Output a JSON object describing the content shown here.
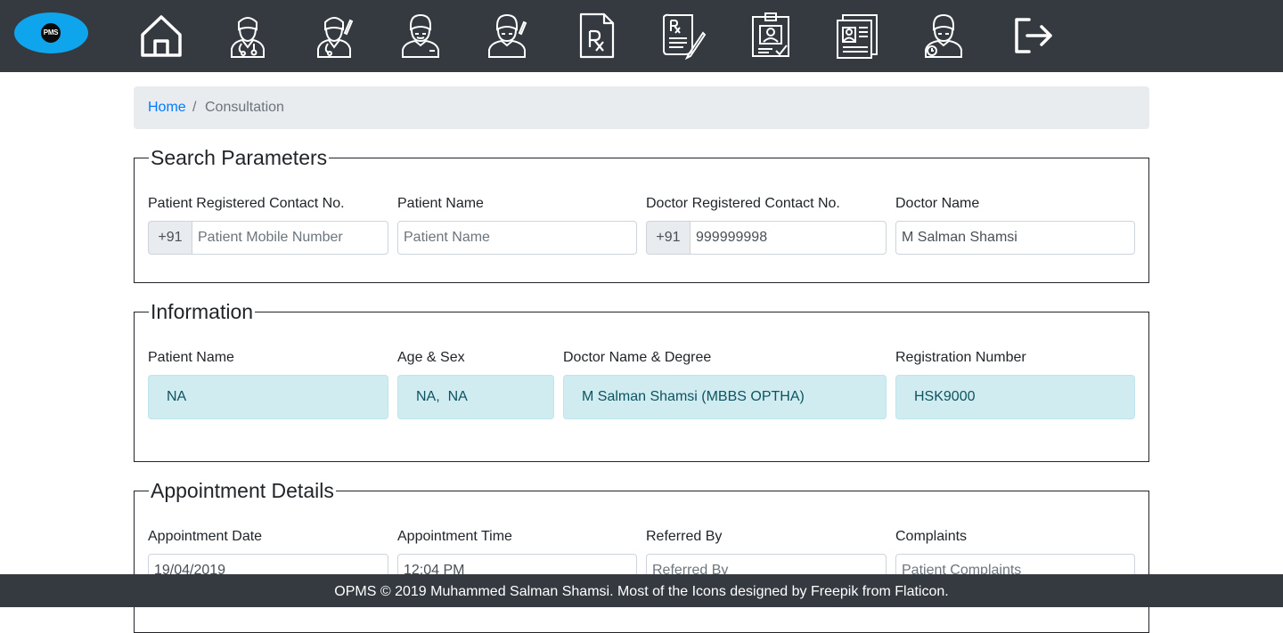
{
  "logo": {
    "text": "PMS"
  },
  "nav": {
    "icons": [
      "home-icon",
      "doctor-icon",
      "doctor-edit-icon",
      "patient-icon",
      "patient-edit-icon",
      "prescription-icon",
      "prescription-write-icon",
      "id-card-check-icon",
      "patient-record-icon",
      "patient-history-icon",
      "logout-icon"
    ]
  },
  "breadcrumb": {
    "home": "Home",
    "separator": "/",
    "current": "Consultation"
  },
  "search": {
    "legend": "Search Parameters",
    "patient_contact_label": "Patient Registered Contact No.",
    "patient_contact_prefix": "+91",
    "patient_contact_placeholder": "Patient Mobile Number",
    "patient_name_label": "Patient Name",
    "patient_name_placeholder": "Patient Name",
    "doctor_contact_label": "Doctor Registered Contact No.",
    "doctor_contact_prefix": "+91",
    "doctor_contact_value": "999999998",
    "doctor_name_label": "Doctor Name",
    "doctor_name_value": "M Salman Shamsi"
  },
  "information": {
    "legend": "Information",
    "patient_name_label": "Patient Name",
    "patient_name_value": "NA",
    "age_sex_label": "Age & Sex",
    "age_sex_value": "NA,  NA",
    "doctor_degree_label": "Doctor Name & Degree",
    "doctor_degree_value": "M Salman Shamsi (MBBS OPTHA)",
    "registration_label": "Registration Number",
    "registration_value": "HSK9000"
  },
  "appointment": {
    "legend": "Appointment Details",
    "date_label": "Appointment Date",
    "date_value": "19/04/2019",
    "time_label": "Appointment Time",
    "time_value": "12:04 PM",
    "referred_label": "Referred By",
    "referred_placeholder": "Referred By",
    "complaints_label": "Complaints",
    "complaints_placeholder": "Patient Complaints"
  },
  "footer": {
    "text": "OPMS © 2019 Muhammed Salman Shamsi. Most of the Icons designed by Freepik from Flaticon."
  },
  "colors": {
    "topbar": "#343a40",
    "link": "#007bff",
    "info_bg": "#d1ecf1",
    "info_text": "#0c5460",
    "logo": "#0ea5ec"
  }
}
